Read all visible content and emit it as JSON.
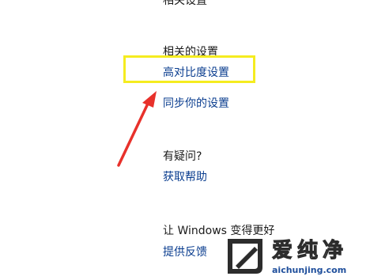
{
  "top_cut_text": "相关设置",
  "related_settings": {
    "heading": "相关的设置",
    "high_contrast": "高对比度设置",
    "sync": "同步你的设置"
  },
  "help": {
    "heading": "有疑问?",
    "get_help": "获取帮助"
  },
  "feedback": {
    "heading": "让 Windows 变得更好",
    "give_feedback": "提供反馈"
  },
  "watermark": {
    "name": "爱纯净",
    "url": "aichunjing.com"
  },
  "colors": {
    "highlight_box": "#f5ec20",
    "arrow": "#e8312b",
    "link": "#0a3d8f"
  }
}
